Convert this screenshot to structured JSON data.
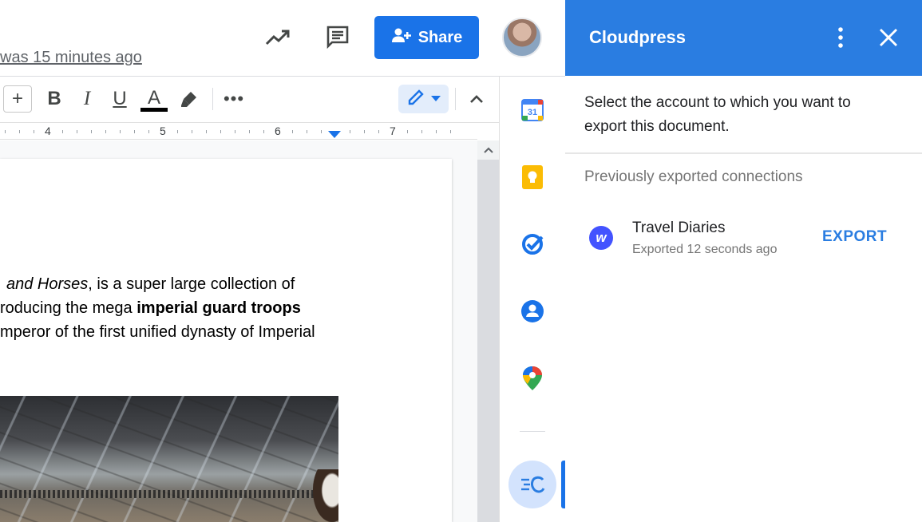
{
  "header": {
    "last_edit": "was 15 minutes ago",
    "share_label": "Share",
    "icons": [
      "activity-trend-icon",
      "comment-icon",
      "share-person-icon",
      "avatar"
    ]
  },
  "toolbar": {
    "plus": "+",
    "bold": "B",
    "italic": "I",
    "underline": "U",
    "text_color": "A",
    "more": "•••"
  },
  "ruler": {
    "marks": [
      "4",
      "5",
      "6",
      "7"
    ]
  },
  "document": {
    "line1_italic": "and Horses",
    "line1_rest": ", is a super large collection of",
    "line2_start": "roducing the mega ",
    "line2_bold": "imperial guard troops",
    "line3": "mperor of the first unified dynasty of Imperial"
  },
  "rail": {
    "calendar_day": "31",
    "items": [
      "calendar-icon",
      "keep-icon",
      "tasks-icon",
      "contacts-icon",
      "maps-icon",
      "cloudpress-icon"
    ]
  },
  "panel": {
    "title": "Cloudpress",
    "intro": "Select the account to which you want to export this document.",
    "section_label": "Previously exported connections",
    "connection": {
      "icon_letter": "w",
      "name": "Travel Diaries",
      "meta": "Exported 12 seconds ago",
      "action": "EXPORT"
    }
  },
  "colors": {
    "panel_header": "#2a7de1",
    "share_button": "#1a73e8",
    "webflow_brand": "#4353ff"
  }
}
